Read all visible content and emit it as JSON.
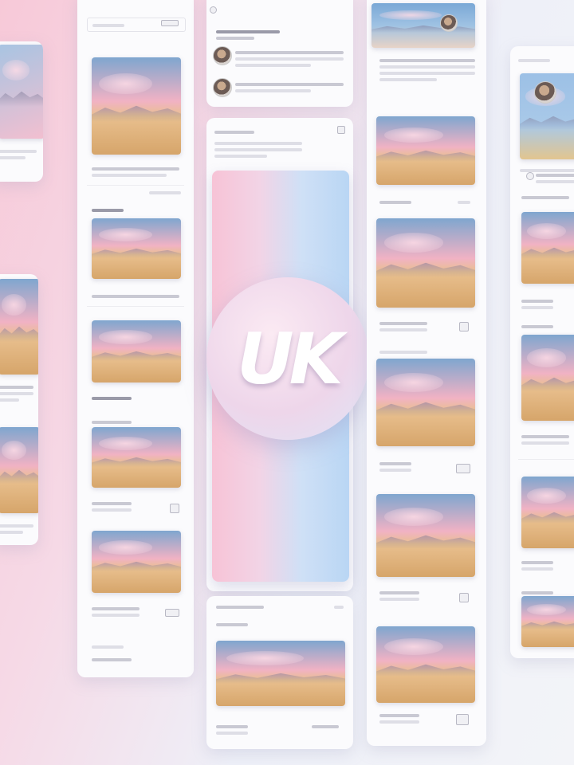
{
  "header": {
    "column_title": "",
    "feed_title": ""
  },
  "logo": {
    "text": "UK"
  },
  "colors": {
    "pink": "#f7c3d6",
    "blue": "#b9d6f4",
    "card": "#fbfbfd"
  },
  "icons": [
    "search-icon",
    "share-icon",
    "image-icon",
    "avatar"
  ]
}
